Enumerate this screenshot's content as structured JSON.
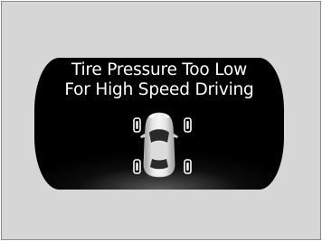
{
  "warning": {
    "line1": "Tire Pressure Too Low",
    "line2": "For High Speed Driving"
  },
  "colors": {
    "frame_background": "#d6d6d6",
    "display_background": "#000000",
    "text": "#ffffff",
    "car_body": "#e0e0e0",
    "tire_indicator": "#ffffff"
  },
  "icons": {
    "car": "car-top-view-icon",
    "tires": [
      "tire-front-left-icon",
      "tire-front-right-icon",
      "tire-rear-left-icon",
      "tire-rear-right-icon"
    ]
  }
}
